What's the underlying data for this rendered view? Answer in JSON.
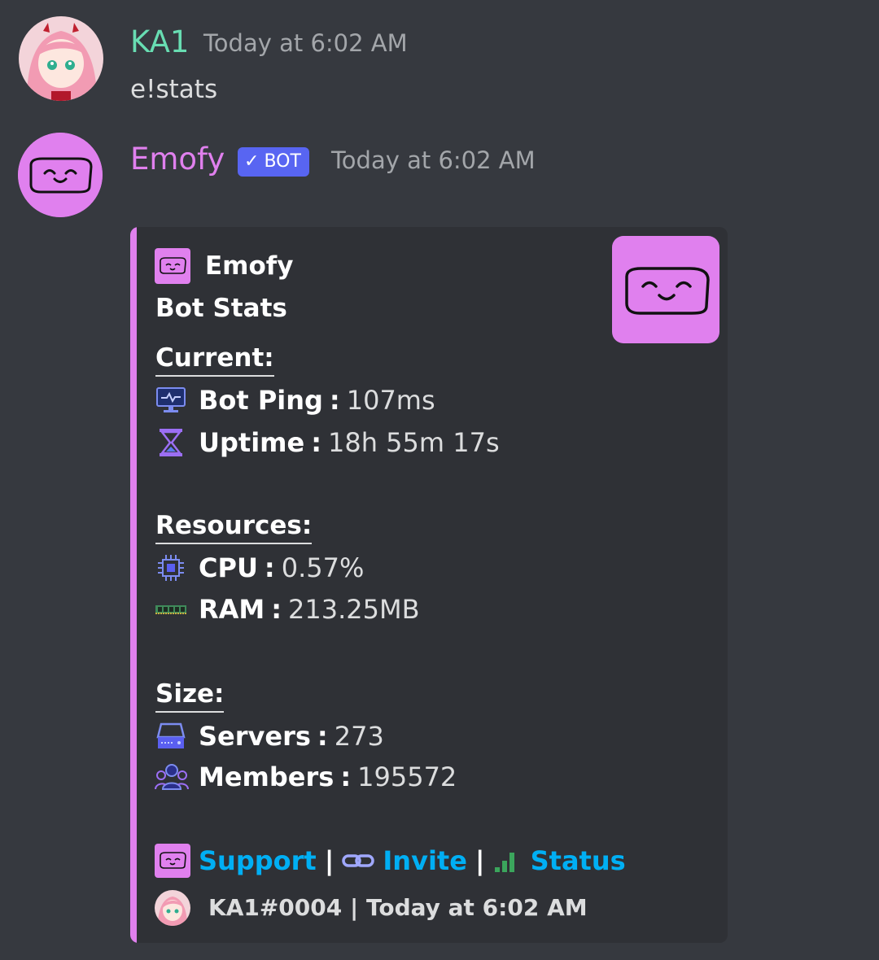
{
  "messages": [
    {
      "username": "KA1",
      "username_color": "#68ddb2",
      "timestamp": "Today at 6:02 AM",
      "content": "e!stats"
    },
    {
      "username": "Emofy",
      "username_color": "#e080ee",
      "bot_tag": "BOT",
      "timestamp": "Today at 6:02 AM"
    }
  ],
  "embed": {
    "accent_color": "#e080ee",
    "author": "Emofy",
    "title": "Bot Stats",
    "sections": {
      "current": {
        "heading": "Current:",
        "rows": [
          {
            "icon": "monitor-icon",
            "label": "Bot Ping",
            "sep": ":",
            "value": "107ms"
          },
          {
            "icon": "hourglass-icon",
            "label": "Uptime",
            "sep": ":",
            "value": "18h 55m 17s"
          }
        ]
      },
      "resources": {
        "heading": "Resources:",
        "rows": [
          {
            "icon": "cpu-chip-icon",
            "label": "CPU",
            "sep": ":",
            "value": "0.57%"
          },
          {
            "icon": "ram-stick-icon",
            "label": "RAM",
            "sep": ":",
            "value": "213.25MB"
          }
        ]
      },
      "size": {
        "heading": "Size:",
        "rows": [
          {
            "icon": "server-icon",
            "label": "Servers",
            "sep": ":",
            "value": "273"
          },
          {
            "icon": "members-icon",
            "label": "Members",
            "sep": ":",
            "value": "195572"
          }
        ]
      }
    },
    "links": {
      "support": "Support",
      "invite": "Invite",
      "status": "Status",
      "separator": "|"
    },
    "footer": {
      "text": "KA1#0004 | Today at 6:02 AM"
    }
  }
}
